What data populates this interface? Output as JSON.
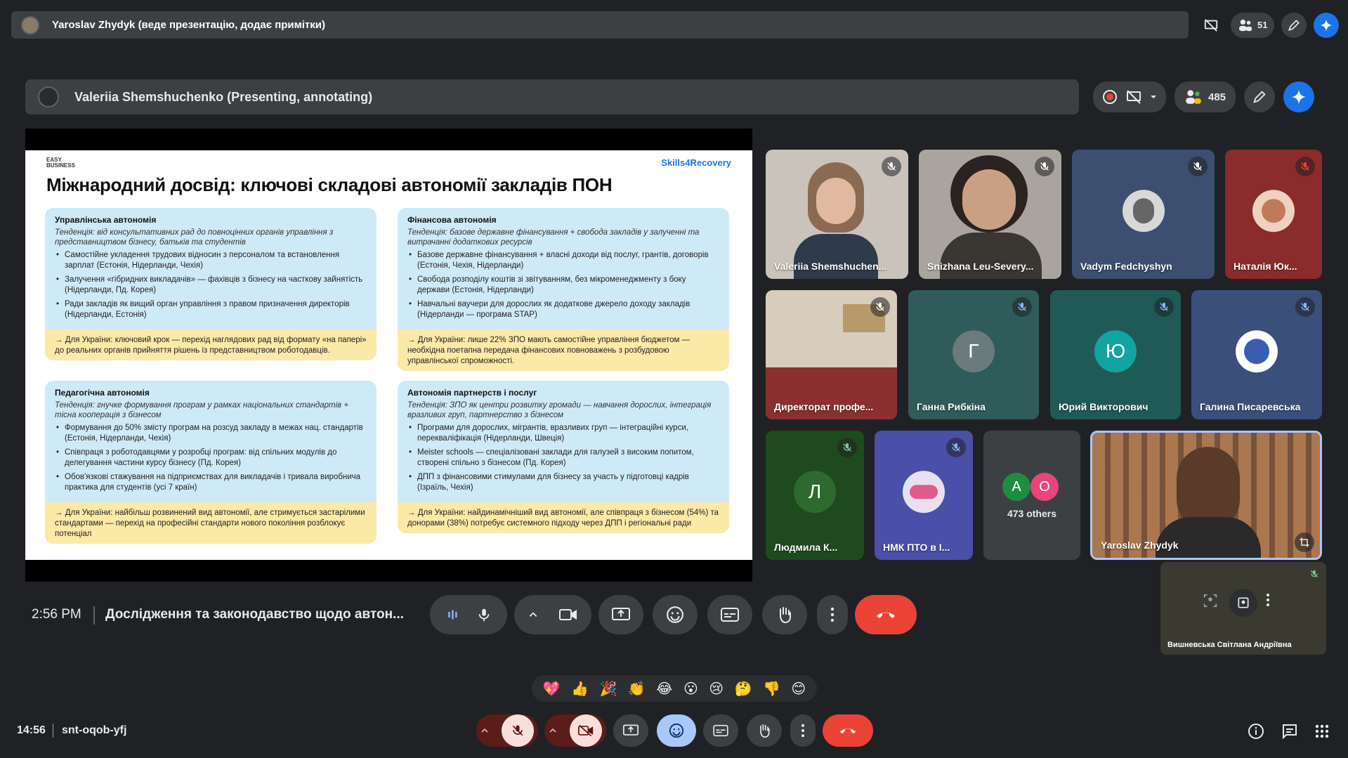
{
  "outer_meeting": {
    "title": "Yaroslav Zhydyk (веде презентацію, додає примітки)",
    "participant_count": "51",
    "time": "14:56",
    "meeting_code": "snt-oqob-yfj"
  },
  "inner_meeting": {
    "title": "Valeriia Shemshuchenko (Presenting, annotating)",
    "participant_count": "485",
    "time": "2:56 PM",
    "meeting_title": "Дослідження та законодавство щодо автон..."
  },
  "slide": {
    "brand": "EASY BUSINESS",
    "tag": "Skills4Recovery",
    "title": "Міжнародний досвід: ключові складові автономії закладів ПОН",
    "cards": [
      {
        "heading": "Управлінська автономія",
        "trend": "Тенденція: від консультативних рад до повноцінних органів управління з представництвом бізнесу, батьків та студентів",
        "bullets": [
          "Самостійне укладення трудових відносин з персоналом та встановлення зарплат (Естонія, Нідерланди, Чехія)",
          "Залучення «гібридних викладачів» — фахівців з бізнесу на часткову зайнятість (Нідерланди, Пд. Корея)",
          "Ради закладів як вищий орган управління з правом призначення директорів (Нідерланди, Естонія)"
        ],
        "ukraine": "→ Для України: ключовий крок — перехід наглядових рад від формату «на папері» до реальних органів прийняття рішень із представництвом роботодавців."
      },
      {
        "heading": "Фінансова автономія",
        "trend": "Тенденція: базове державне фінансування + свобода закладів у залученні та витрачанні додаткових ресурсів",
        "bullets": [
          "Базове державне фінансування + власні доходи від послуг, грантів, договорів (Естонія, Чехія, Нідерланди)",
          "Свобода розподілу коштів зі звітуванням, без мікроменеджменту з боку держави (Естонія, Нідерланди)",
          "Навчальні ваучери для дорослих як додаткове джерело доходу закладів (Нідерланди — програма STAP)"
        ],
        "ukraine": "→ Для України: лише 22% ЗПО мають самостійне управління бюджетом — необхідна поетапна передача фінансових повноважень з розбудовою управлінської спроможності."
      },
      {
        "heading": "Педагогічна автономія",
        "trend": "Тенденція: гнучке формування програм у рамках національних стандартів + тісна кооперація з бізнесом",
        "bullets": [
          "Формування до 50% змісту програм на розсуд закладу в межах нац. стандартів (Естонія, Нідерланди, Чехія)",
          "Співпраця з роботодавцями у розробці програм: від спільних модулів до делегування частини курсу бізнесу (Пд. Корея)",
          "Обов'язкові стажування на підприємствах для викладачів і тривала виробнича практика для студентів (усі 7 країн)"
        ],
        "ukraine": "→ Для України: найбільш розвинений вид автономії, але стримується застарілими стандартами — перехід на професійні стандарти нового покоління розблокує потенціал"
      },
      {
        "heading": "Автономія партнерств і послуг",
        "trend": "Тенденція: ЗПО як центри розвитку громади — навчання дорослих, інтеграція вразливих груп, партнерство з бізнесом",
        "bullets": [
          "Програми для дорослих, мігрантів, вразливих груп — інтеграційні курси, перекваліфікація (Нідерланди, Швеція)",
          "Meister schools — спеціалізовані заклади для галузей з високим попитом, створені спільно з бізнесом (Пд. Корея)",
          "ДПП з фінансовими стимулами для бізнесу за участь у підготовці кадрів (Ізраїль, Чехія)"
        ],
        "ukraine": "→ Для України: найдинамічніший вид автономії, але співпраця з бізнесом (54%) та донорами (38%) потребує системного підходу через ДПП і регіональні ради"
      }
    ]
  },
  "participants": [
    {
      "name": "Valeriia Shemshuchen...",
      "bg": "#c9c3bb"
    },
    {
      "name": "Snizhana Leu-Severy...",
      "bg": "#a9a49d"
    },
    {
      "name": "Vadym Fedchyshyn",
      "bg": "#3c4f70"
    },
    {
      "name": "Наталія Юк...",
      "bg": "#8b2b2b"
    },
    {
      "name": "Директорат профе...",
      "bg": "#a38f7a"
    },
    {
      "name": "Ганна Рибкіна",
      "initial": "Г",
      "bg": "#2f5b5b",
      "avatar": "#6b7b7b"
    },
    {
      "name": "Юрий Викторович",
      "initial": "Ю",
      "bg": "#1f5a57",
      "avatar": "#12a4a0"
    },
    {
      "name": "Галина Писаревська",
      "bg": "#3a4f7a"
    },
    {
      "name": "Людмила К...",
      "initial": "Л",
      "bg": "#1f4a1f",
      "avatar": "#2e6a2e"
    },
    {
      "name": "НМК ПТО в І...",
      "bg": "#4a4fa8"
    },
    {
      "name": "473 others",
      "initial_a": "А",
      "initial_b": "О"
    },
    {
      "name": "Yaroslav Zhydyk",
      "bg": "#9a6f50"
    }
  ],
  "self_view": {
    "name": "Вишневська Світлана Андріївна"
  },
  "reactions": [
    "💖",
    "👍",
    "🎉",
    "👏",
    "😂",
    "😮",
    "😢",
    "🤔",
    "👎",
    "😊"
  ],
  "colors": {
    "accent": "#1a73e8",
    "hangup": "#ea4335",
    "panel": "#3c4043",
    "bg": "#202124"
  }
}
